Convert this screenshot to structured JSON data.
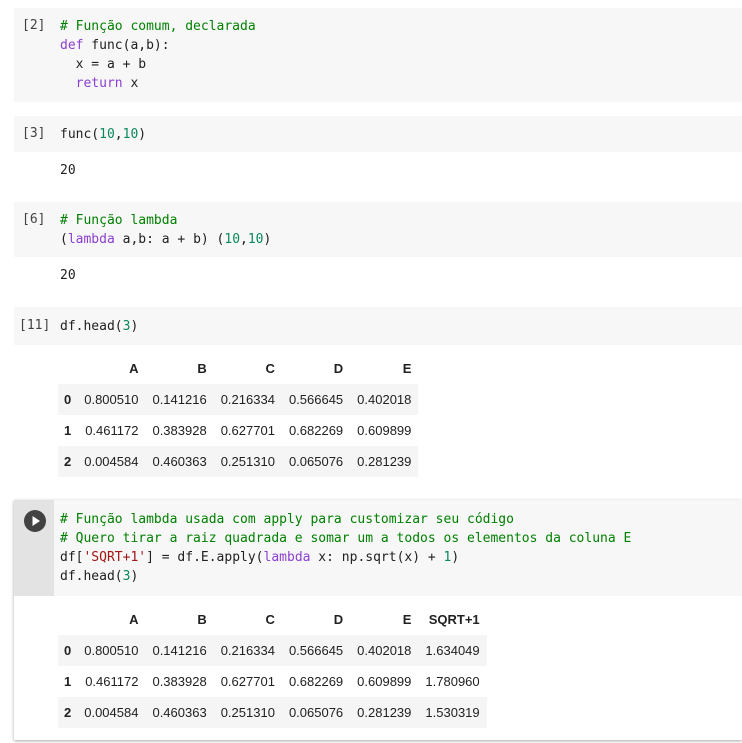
{
  "cells": [
    {
      "prompt": "[2]",
      "lines": [
        [
          {
            "t": "# Função comum, declarada",
            "c": "c-com"
          }
        ],
        [
          {
            "t": "def",
            "c": "c-kw"
          },
          {
            "t": " func(a,b):",
            "c": ""
          }
        ],
        [
          {
            "t": "  x = a + b",
            "c": ""
          }
        ],
        [
          {
            "t": "  ",
            "c": ""
          },
          {
            "t": "return",
            "c": "c-kw"
          },
          {
            "t": " x",
            "c": ""
          }
        ]
      ]
    },
    {
      "prompt": "[3]",
      "lines": [
        [
          {
            "t": "func(",
            "c": ""
          },
          {
            "t": "10",
            "c": "c-num"
          },
          {
            "t": ",",
            "c": ""
          },
          {
            "t": "10",
            "c": "c-num"
          },
          {
            "t": ")",
            "c": ""
          }
        ]
      ],
      "output": "20"
    },
    {
      "prompt": "[6]",
      "lines": [
        [
          {
            "t": "# Função lambda",
            "c": "c-com"
          }
        ],
        [
          {
            "t": "(",
            "c": ""
          },
          {
            "t": "lambda",
            "c": "c-kw"
          },
          {
            "t": " a,b: a + b) (",
            "c": ""
          },
          {
            "t": "10",
            "c": "c-num"
          },
          {
            "t": ",",
            "c": ""
          },
          {
            "t": "10",
            "c": "c-num"
          },
          {
            "t": ")",
            "c": ""
          }
        ]
      ],
      "output": "20"
    },
    {
      "prompt": "[11]",
      "lines": [
        [
          {
            "t": "df.head(",
            "c": ""
          },
          {
            "t": "3",
            "c": "c-num"
          },
          {
            "t": ")",
            "c": ""
          }
        ]
      ]
    },
    {
      "prompt": "",
      "lines": [
        [
          {
            "t": "# Função lambda usada com apply para customizar seu código",
            "c": "c-com"
          }
        ],
        [
          {
            "t": "# Quero tirar a raiz quadrada e somar um a todos os elementos da coluna E",
            "c": "c-com"
          }
        ],
        [
          {
            "t": "df[",
            "c": ""
          },
          {
            "t": "'SQRT+1'",
            "c": "c-str"
          },
          {
            "t": "] = df.E.apply(",
            "c": ""
          },
          {
            "t": "lambda",
            "c": "c-kw"
          },
          {
            "t": " x: np.sqrt(x) + ",
            "c": ""
          },
          {
            "t": "1",
            "c": "c-num"
          },
          {
            "t": ")",
            "c": ""
          }
        ],
        [
          {
            "t": "df.head(",
            "c": ""
          },
          {
            "t": "3",
            "c": "c-num"
          },
          {
            "t": ")",
            "c": ""
          }
        ]
      ]
    }
  ],
  "tables": [
    {
      "columns": [
        "",
        "A",
        "B",
        "C",
        "D",
        "E"
      ],
      "rows": [
        [
          "0",
          "0.800510",
          "0.141216",
          "0.216334",
          "0.566645",
          "0.402018"
        ],
        [
          "1",
          "0.461172",
          "0.383928",
          "0.627701",
          "0.682269",
          "0.609899"
        ],
        [
          "2",
          "0.004584",
          "0.460363",
          "0.251310",
          "0.065076",
          "0.281239"
        ]
      ]
    },
    {
      "columns": [
        "",
        "A",
        "B",
        "C",
        "D",
        "E",
        "SQRT+1"
      ],
      "rows": [
        [
          "0",
          "0.800510",
          "0.141216",
          "0.216334",
          "0.566645",
          "0.402018",
          "1.634049"
        ],
        [
          "1",
          "0.461172",
          "0.383928",
          "0.627701",
          "0.682269",
          "0.609899",
          "1.780960"
        ],
        [
          "2",
          "0.004584",
          "0.460363",
          "0.251310",
          "0.065076",
          "0.281239",
          "1.530319"
        ]
      ]
    }
  ],
  "run_button_icon": "play-icon"
}
